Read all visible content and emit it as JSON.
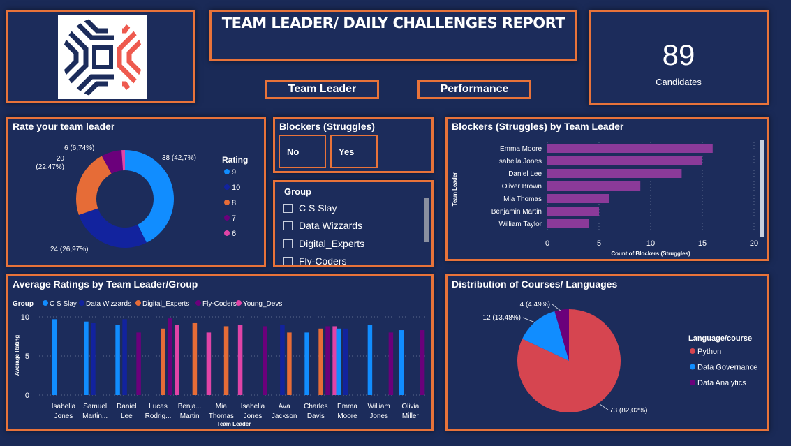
{
  "header": {
    "title": "TEAM LEADER/ DAILY CHALLENGES REPORT",
    "nav": [
      "Team Leader",
      "Performance"
    ]
  },
  "card": {
    "value": "89",
    "label": "Candidates"
  },
  "colors": {
    "accent": "#e8733a",
    "background": "#1a2a57",
    "panel": "#1c2c5b",
    "rating9": "#118dff",
    "rating10": "#12239e",
    "rating8": "#e66c37",
    "rating7": "#6b007b",
    "rating6": "#e044a7",
    "bar_purple": "#8b3a99",
    "python": "#d64550"
  },
  "blockers_slicer": {
    "title": "Blockers (Struggles)",
    "options": [
      "No",
      "Yes"
    ]
  },
  "group_slicer": {
    "title": "Group",
    "items": [
      "C S Slay",
      "Data Wizzards",
      "Digital_Experts",
      "Fly-Coders"
    ]
  },
  "logo": {
    "icon": "chevron-cross-logo"
  },
  "chart_data": [
    {
      "id": "rating-donut",
      "type": "pie",
      "title": "Rate your team leader",
      "legend_title": "Rating",
      "legend_position": "right",
      "slices": [
        {
          "label": "9",
          "value": 38,
          "display": "38 (42,7%)",
          "color": "#118dff"
        },
        {
          "label": "10",
          "value": 24,
          "display": "24 (26,97%)",
          "color": "#12239e"
        },
        {
          "label": "8",
          "value": 20,
          "display": "20\n(22,47%)",
          "color": "#e66c37"
        },
        {
          "label": "7",
          "value": 6,
          "display": "6 (6,74%)",
          "color": "#6b007b"
        },
        {
          "label": "6",
          "value": 1,
          "display": "",
          "color": "#e044a7"
        }
      ]
    },
    {
      "id": "blockers-bar",
      "type": "bar",
      "orientation": "horizontal",
      "title": "Blockers (Struggles) by Team Leader",
      "xlabel": "Count of Blockers (Struggles)",
      "ylabel": "Team Leader",
      "xlim": [
        0,
        20
      ],
      "xticks": [
        0,
        5,
        10,
        15,
        20
      ],
      "grid": true,
      "categories": [
        "Emma Moore",
        "Isabella Jones",
        "Daniel Lee",
        "Oliver Brown",
        "Mia Thomas",
        "Benjamin Martin",
        "William Taylor"
      ],
      "values": [
        16,
        15,
        13,
        9,
        6,
        5,
        4
      ]
    },
    {
      "id": "avg-ratings",
      "type": "bar",
      "title": "Average Ratings by Team Leader/Group",
      "legend_title": "Group",
      "legend_position": "top-left",
      "xlabel": "Team Leader",
      "ylabel": "Average Rating",
      "ylim": [
        0,
        10
      ],
      "yticks": [
        0,
        5,
        10
      ],
      "grid": true,
      "series_colors": {
        "C S Slay": "#118dff",
        "Data Wizzards": "#12239e",
        "Digital_Experts": "#e66c37",
        "Fly-Coders": "#6b007b",
        "Young_Devs": "#e044a7"
      },
      "categories": [
        {
          "label": [
            "Isabella",
            "Jones"
          ],
          "bars": [
            {
              "series": "C S Slay",
              "value": 9.7
            }
          ]
        },
        {
          "label": [
            "Samuel",
            "Martin..."
          ],
          "bars": [
            {
              "series": "C S Slay",
              "value": 9.4
            },
            {
              "series": "Data Wizzards",
              "value": 9.2
            }
          ]
        },
        {
          "label": [
            "Daniel",
            "Lee"
          ],
          "bars": [
            {
              "series": "C S Slay",
              "value": 9.0
            },
            {
              "series": "Data Wizzards",
              "value": 9.7
            },
            {
              "series": "Fly-Coders",
              "value": 8.0
            }
          ]
        },
        {
          "label": [
            "Lucas",
            "Rodrig..."
          ],
          "bars": [
            {
              "series": "Digital_Experts",
              "value": 8.5
            },
            {
              "series": "Fly-Coders",
              "value": 9.8
            },
            {
              "series": "Young_Devs",
              "value": 9.0
            }
          ]
        },
        {
          "label": [
            "Benja...",
            "Martin"
          ],
          "bars": [
            {
              "series": "Digital_Experts",
              "value": 9.2
            },
            {
              "series": "Young_Devs",
              "value": 8.0
            }
          ]
        },
        {
          "label": [
            "Mia",
            "Thomas"
          ],
          "bars": [
            {
              "series": "Digital_Experts",
              "value": 8.8
            },
            {
              "series": "Young_Devs",
              "value": 9.0
            }
          ]
        },
        {
          "label": [
            "Isabella",
            "Jones"
          ],
          "bars": [
            {
              "series": "Fly-Coders",
              "value": 8.8
            }
          ]
        },
        {
          "label": [
            "Ava",
            "Jackson"
          ],
          "bars": [
            {
              "series": "Data Wizzards",
              "value": 9.0
            },
            {
              "series": "Digital_Experts",
              "value": 8.0
            }
          ]
        },
        {
          "label": [
            "Charles",
            "Davis"
          ],
          "bars": [
            {
              "series": "C S Slay",
              "value": 8.0
            },
            {
              "series": "Digital_Experts",
              "value": 8.5
            },
            {
              "series": "Fly-Coders",
              "value": 8.8
            },
            {
              "series": "Young_Devs",
              "value": 8.8
            }
          ]
        },
        {
          "label": [
            "Emma",
            "Moore"
          ],
          "bars": [
            {
              "series": "C S Slay",
              "value": 8.5
            },
            {
              "series": "Data Wizzards",
              "value": 8.5
            }
          ]
        },
        {
          "label": [
            "William",
            "Jones"
          ],
          "bars": [
            {
              "series": "C S Slay",
              "value": 9.0
            },
            {
              "series": "Fly-Coders",
              "value": 8.0
            }
          ]
        },
        {
          "label": [
            "Olivia",
            "Miller"
          ],
          "bars": [
            {
              "series": "C S Slay",
              "value": 8.3
            },
            {
              "series": "Fly-Coders",
              "value": 8.3
            }
          ]
        }
      ]
    },
    {
      "id": "courses-pie",
      "type": "pie",
      "title": "Distribution of Courses/ Languages",
      "legend_title": "Language/course",
      "legend_position": "right",
      "slices": [
        {
          "label": "Python",
          "value": 73,
          "display": "73 (82,02%)",
          "color": "#d64550"
        },
        {
          "label": "Data Governance",
          "value": 12,
          "display": "12 (13,48%)",
          "color": "#118dff"
        },
        {
          "label": "Data Analytics",
          "value": 4,
          "display": "4 (4,49%)",
          "color": "#6b007b"
        }
      ]
    }
  ]
}
